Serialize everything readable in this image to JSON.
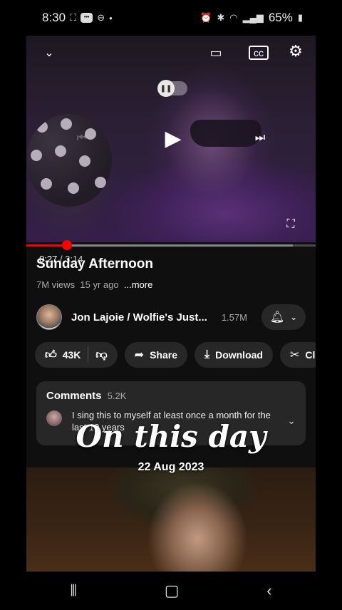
{
  "status_bar": {
    "time": "8:30",
    "battery": "65%"
  },
  "player": {
    "current_time": "0:27",
    "duration": "/ 3:14",
    "progress_fraction": 0.14,
    "buffered_fraction": 0.92
  },
  "video": {
    "title": "Sunday Afternoon",
    "views": "7M views",
    "age": "15 yr ago",
    "more_label": "...more"
  },
  "channel": {
    "name": "Jon Lajoie / Wolfie's Just...",
    "subscribers": "1.57M"
  },
  "actions": {
    "likes": "43K",
    "share": "Share",
    "download": "Download",
    "clip": "Cl"
  },
  "comments": {
    "heading": "Comments",
    "count": "5.2K",
    "top_comment": "I sing this to myself at least once a month for the last 10 years"
  },
  "overlay": {
    "title": "On this day",
    "date": "22 Aug 2023"
  },
  "colors": {
    "accent": "#ff0000",
    "surface": "#272727",
    "background": "#0f0f0f"
  }
}
